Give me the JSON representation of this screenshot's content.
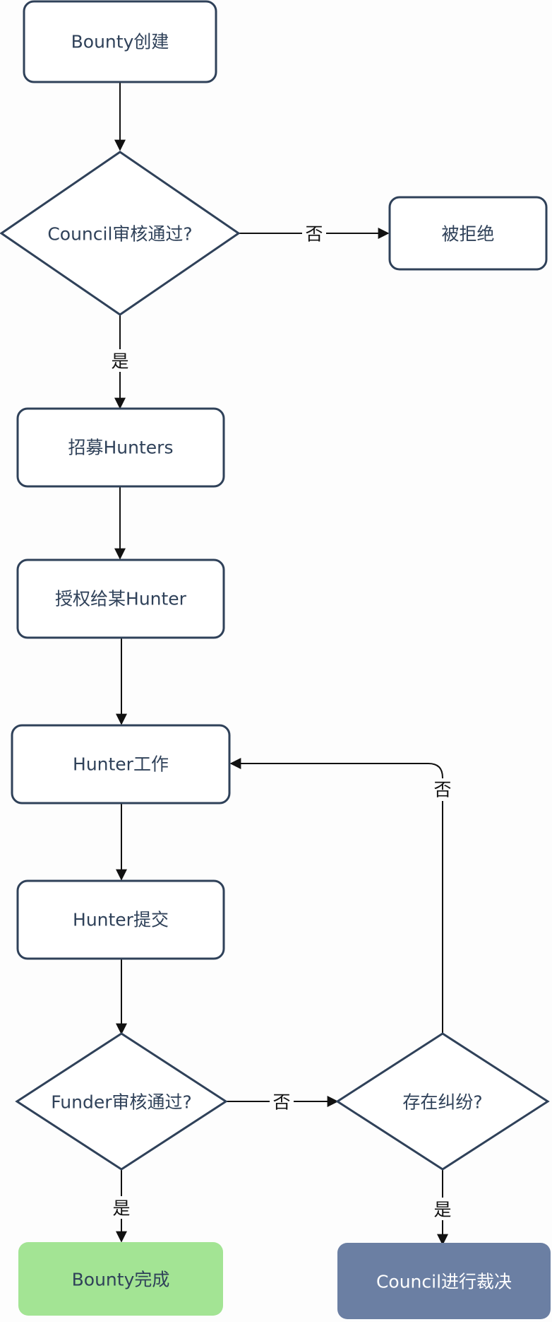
{
  "nodes": {
    "bounty_created": {
      "label": "Bounty创建"
    },
    "council_review": {
      "label": "Council审核通过?"
    },
    "rejected": {
      "label": "被拒绝",
      "fill": "#e6e6e6"
    },
    "recruit_hunters": {
      "label": "招募Hunters"
    },
    "authorize_hunter": {
      "label": "授权给某Hunter"
    },
    "hunter_work": {
      "label": "Hunter工作"
    },
    "hunter_submit": {
      "label": "Hunter提交"
    },
    "funder_review": {
      "label": "Funder审核通过?"
    },
    "dispute": {
      "label": "存在纠纷?"
    },
    "bounty_done": {
      "label": "Bounty完成",
      "fill": "#a3e494"
    },
    "council_arbitration": {
      "label": "Council进行裁决",
      "fill": "#6b7fa3"
    }
  },
  "edges": {
    "council_no": "否",
    "council_yes": "是",
    "funder_no": "否",
    "funder_yes": "是",
    "dispute_no": "否",
    "dispute_yes": "是"
  }
}
